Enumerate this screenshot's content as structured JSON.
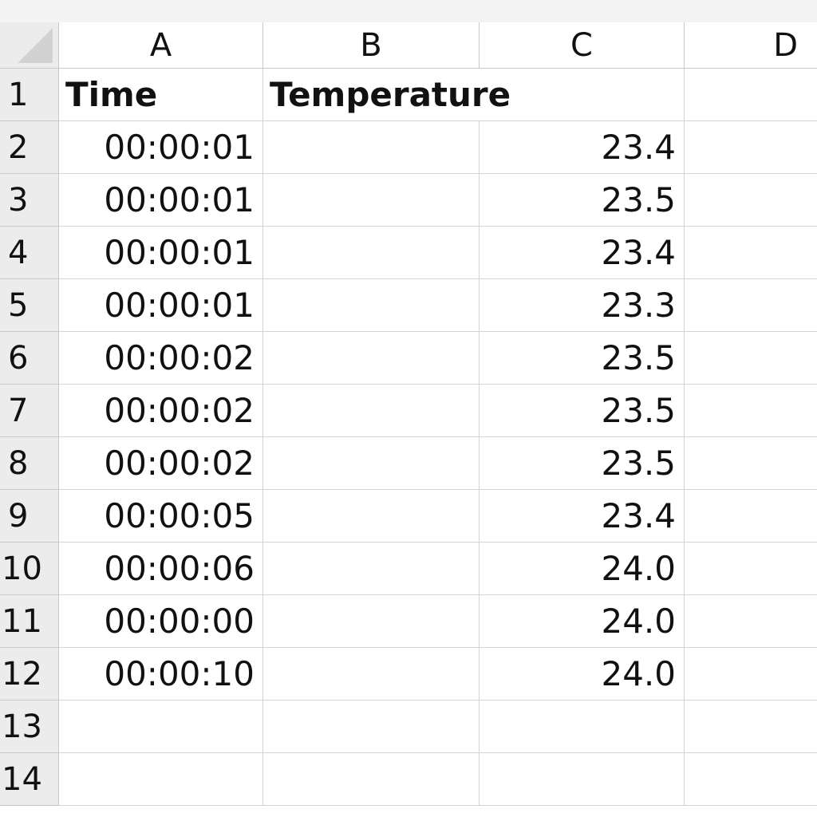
{
  "columns": [
    "A",
    "B",
    "C",
    "D"
  ],
  "rows": [
    {
      "num": "1",
      "time": "Time",
      "temp": "",
      "header_b": "Temperature"
    },
    {
      "num": "2",
      "time": "00:00:01",
      "temp": "23.4"
    },
    {
      "num": "3",
      "time": "00:00:01",
      "temp": "23.5"
    },
    {
      "num": "4",
      "time": "00:00:01",
      "temp": "23.4"
    },
    {
      "num": "5",
      "time": "00:00:01",
      "temp": "23.3"
    },
    {
      "num": "6",
      "time": "00:00:02",
      "temp": "23.5"
    },
    {
      "num": "7",
      "time": "00:00:02",
      "temp": "23.5"
    },
    {
      "num": "8",
      "time": "00:00:02",
      "temp": "23.5"
    },
    {
      "num": "9",
      "time": "00:00:05",
      "temp": "23.4"
    },
    {
      "num": "10",
      "time": "00:00:06",
      "temp": "24.0"
    },
    {
      "num": "11",
      "time": "00:00:00",
      "temp": "24.0"
    },
    {
      "num": "12",
      "time": "00:00:10",
      "temp": "24.0"
    },
    {
      "num": "13",
      "time": "",
      "temp": ""
    },
    {
      "num": "14",
      "time": "",
      "temp": ""
    }
  ]
}
